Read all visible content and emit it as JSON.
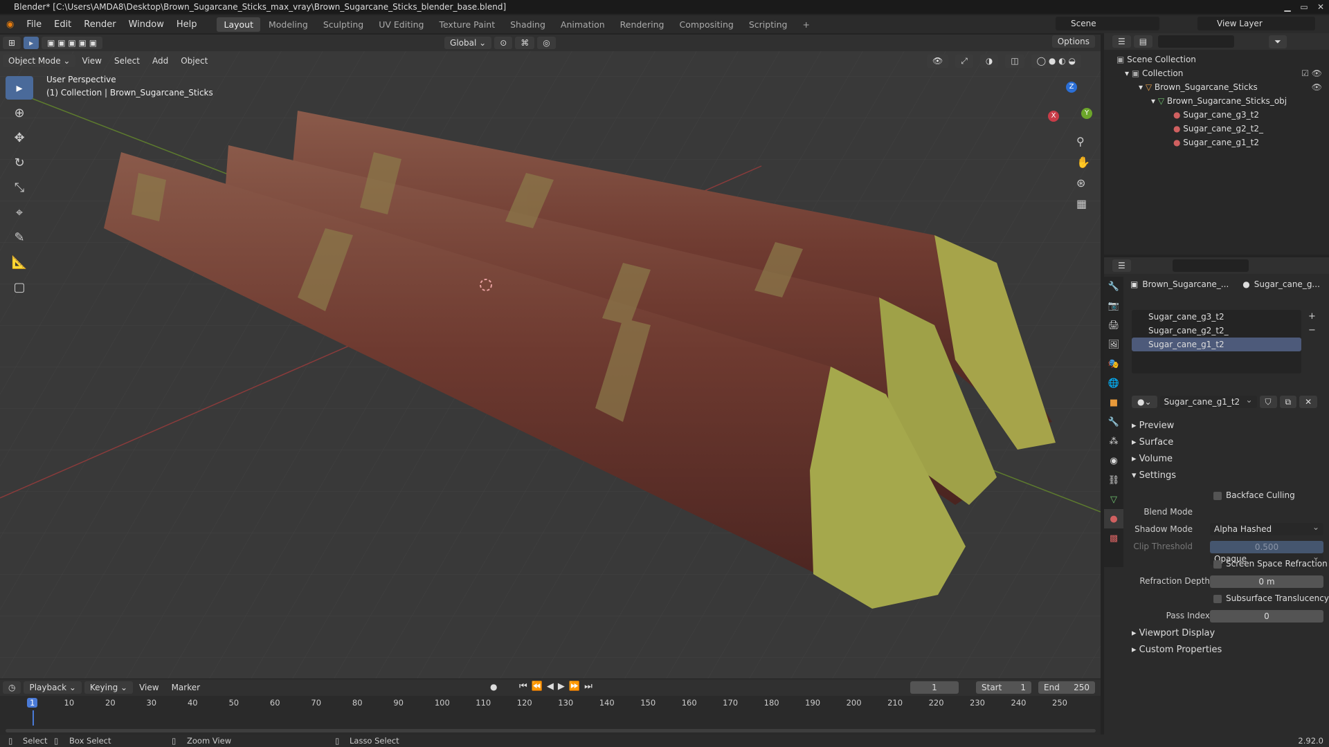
{
  "window": {
    "title": "Blender* [C:\\Users\\AMDA8\\Desktop\\Brown_Sugarcane_Sticks_max_vray\\Brown_Sugarcane_Sticks_blender_base.blend]"
  },
  "menus": [
    "File",
    "Edit",
    "Render",
    "Window",
    "Help"
  ],
  "workspaces": [
    "Layout",
    "Modeling",
    "Sculpting",
    "UV Editing",
    "Texture Paint",
    "Shading",
    "Animation",
    "Rendering",
    "Compositing",
    "Scripting"
  ],
  "scene": {
    "label": "Scene",
    "view_layer": "View Layer"
  },
  "toolhdr": {
    "transform": "Global",
    "options": "Options"
  },
  "vphdr": {
    "mode": "Object Mode",
    "items": [
      "View",
      "Select",
      "Add",
      "Object"
    ]
  },
  "overlay": {
    "perspective": "User Perspective",
    "collection": "(1) Collection | Brown_Sugarcane_Sticks"
  },
  "gizmo": {
    "x": "X",
    "y": "Y",
    "z": "Z"
  },
  "outliner": {
    "items": [
      {
        "label": "Scene Collection",
        "indent": 0
      },
      {
        "label": "Collection",
        "indent": 1
      },
      {
        "label": "Brown_Sugarcane_Sticks",
        "indent": 2
      },
      {
        "label": "Brown_Sugarcane_Sticks_obj",
        "indent": 3
      },
      {
        "label": "Sugar_cane_g3_t2",
        "indent": 4
      },
      {
        "label": "Sugar_cane_g2_t2_",
        "indent": 4
      },
      {
        "label": "Sugar_cane_g1_t2",
        "indent": 4
      }
    ]
  },
  "props": {
    "crumb_obj": "Brown_Sugarcane_...",
    "crumb_mat": "Sugar_cane_g...",
    "slots": [
      "Sugar_cane_g3_t2",
      "Sugar_cane_g2_t2_",
      "Sugar_cane_g1_t2"
    ],
    "material": "Sugar_cane_g1_t2",
    "sections": {
      "preview": "Preview",
      "surface": "Surface",
      "volume": "Volume",
      "settings": "Settings",
      "viewport_display": "Viewport Display",
      "custom": "Custom Properties"
    },
    "backface": "Backface Culling",
    "blend_label": "Blend Mode",
    "blend_value": "Alpha Hashed",
    "shadow_label": "Shadow Mode",
    "shadow_value": "Opaque",
    "clip_label": "Clip Threshold",
    "clip_value": "0.500",
    "ssr": "Screen Space Refraction",
    "refr_label": "Refraction Depth",
    "refr_value": "0 m",
    "sss": "Subsurface Translucency",
    "pass_label": "Pass Index",
    "pass_value": "0"
  },
  "timeline": {
    "menus": [
      "Playback",
      "Keying",
      "View",
      "Marker"
    ],
    "frame": "1",
    "start_label": "Start",
    "start": "1",
    "end_label": "End",
    "end": "250",
    "ticks": [
      "1",
      "10",
      "20",
      "30",
      "40",
      "50",
      "60",
      "70",
      "80",
      "90",
      "100",
      "110",
      "120",
      "130",
      "140",
      "150",
      "160",
      "170",
      "180",
      "190",
      "200",
      "210",
      "220",
      "230",
      "240",
      "250"
    ]
  },
  "status": {
    "select": "Select",
    "box": "Box Select",
    "zoom": "Zoom View",
    "lasso": "Lasso Select",
    "version": "2.92.0"
  }
}
